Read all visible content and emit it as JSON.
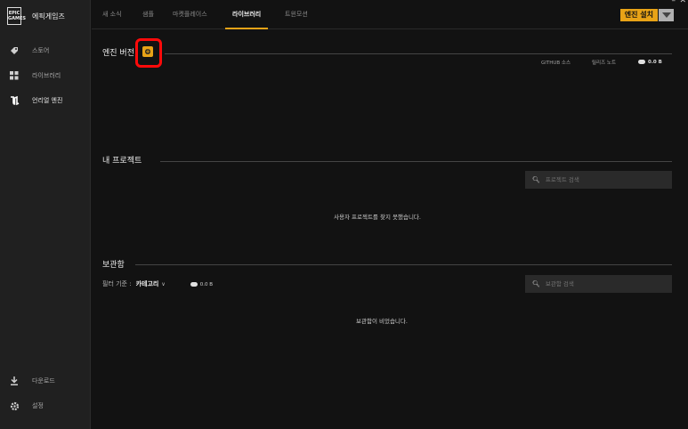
{
  "brand": {
    "logo_text": "EPIC GAMES",
    "name": "에픽게임즈"
  },
  "sidebar": {
    "items": [
      {
        "label": "스토어",
        "icon": "tag-icon"
      },
      {
        "label": "라이브러리",
        "icon": "grid-icon"
      },
      {
        "label": "언리얼 엔진",
        "icon": "unreal-icon"
      }
    ],
    "bottom": [
      {
        "label": "다운로드",
        "icon": "download-icon"
      },
      {
        "label": "설정",
        "icon": "gear-icon"
      }
    ]
  },
  "tabs": [
    {
      "label": "새 소식"
    },
    {
      "label": "샘플"
    },
    {
      "label": "마켓플레이스"
    },
    {
      "label": "라이브러리",
      "active": true
    },
    {
      "label": "트윈모션"
    }
  ],
  "header": {
    "install_button": "엔진 설치"
  },
  "engine_section": {
    "title": "엔진 버전",
    "links": {
      "github": "GITHUB 소스",
      "release_notes": "릴리즈 노트",
      "storage": "0.0 B"
    }
  },
  "projects_section": {
    "title": "내 프로젝트",
    "search_placeholder": "프로젝트 검색",
    "empty_message": "사용자 프로젝트를 찾지 못했습니다."
  },
  "vault_section": {
    "title": "보관함",
    "filter_label": "필터 기준 :",
    "filter_value": "카테고리",
    "storage": "0.0 B",
    "search_placeholder": "보관함 검색",
    "empty_message": "보관함이 비었습니다."
  },
  "colors": {
    "accent": "#e8a317",
    "highlight": "#ff0a0a",
    "background": "#121212",
    "sidebar": "#202020"
  }
}
